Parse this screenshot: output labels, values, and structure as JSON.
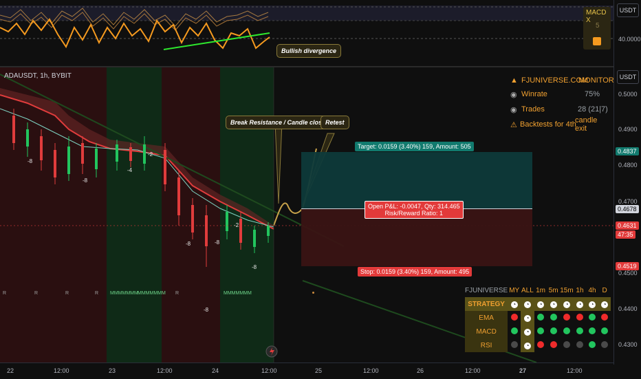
{
  "indicator": {
    "title": "MACD X",
    "value_label": "5",
    "price_unit": "USDT",
    "level": "40.0000",
    "divergence_label": "Bullish divergence"
  },
  "chart": {
    "symbol": "ADAUSDT, 1h, BYBIT",
    "price_unit": "USDT",
    "price_ticks": [
      "0.5000",
      "0.4900",
      "0.4800",
      "0.4700",
      "0.4500",
      "0.4400",
      "0.4300"
    ],
    "time_ticks": [
      "22",
      "12:00",
      "23",
      "12:00",
      "24",
      "12:00",
      "25",
      "12:00",
      "26",
      "12:00",
      "27",
      "12:00"
    ],
    "target_price_tag": "0.4837",
    "current_price_tag": "0.4678",
    "last_price_tag": "0.4631",
    "countdown": "47:35",
    "stop_price_tag": "0.4519",
    "bar_marker": "-8",
    "bar_marker_2": "-2",
    "bar_marker_3": "-4",
    "signal_r": "R",
    "signal_m": "MMMMMMM"
  },
  "callouts": {
    "break_resistance": "Break Resistance / Candle close",
    "retest": "Retest"
  },
  "position": {
    "target_label": "Target: 0.0159 (3.40%) 159, Amount: 505",
    "open_pnl_label": "Open P&L: -0.0047, Qty: 314.465",
    "risk_reward_label": "Risk/Reward Ratio: 1",
    "stop_label": "Stop: 0.0159 (3.40%) 159, Amount: 495"
  },
  "monitor": {
    "brand": "FJUNIVERSE.COM",
    "mode": "MONITOR",
    "winrate_label": "Winrate",
    "winrate_value": "75%",
    "trades_label": "Trades",
    "trades_value": "28 (21|7)",
    "backtest_label": "Backtests for 4th",
    "backtest_value": "candle exit"
  },
  "strategy_table": {
    "brand": "FJUNIVERSE",
    "columns": [
      "MY",
      "ALL",
      "1m",
      "5m",
      "15m",
      "1h",
      "4h",
      "D"
    ],
    "header_label": "STRATEGY",
    "rows": [
      {
        "name": "EMA",
        "cells": [
          "red",
          "clock",
          "green",
          "green",
          "red",
          "red",
          "green",
          "red"
        ]
      },
      {
        "name": "MACD",
        "cells": [
          "green",
          "clock",
          "green",
          "green",
          "green",
          "green",
          "green",
          "green"
        ]
      },
      {
        "name": "RSI",
        "cells": [
          "gray",
          "clock",
          "red",
          "red",
          "gray",
          "gray",
          "green",
          "gray"
        ]
      }
    ]
  },
  "colors": {
    "green": "#22c55e",
    "red": "#ef2b2b",
    "orange": "#f0a030",
    "target_fill": "#0e3a3a",
    "stop_fill": "#3a1414"
  }
}
